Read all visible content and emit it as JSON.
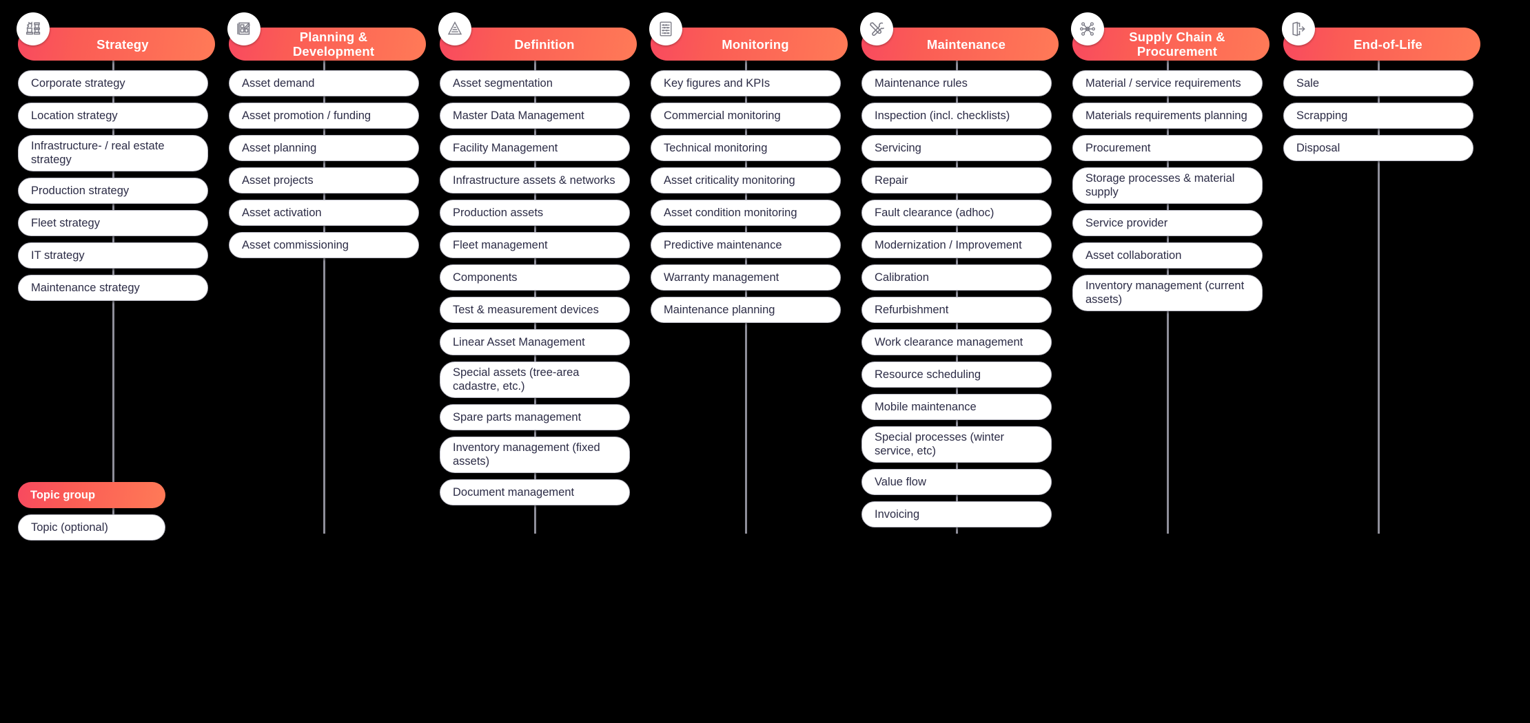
{
  "theme": {
    "background": "#000000",
    "accent_start": "#f8495f",
    "accent_end": "#ff7a57",
    "pill_background": "#ffffff",
    "pill_text": "#2c2c46",
    "connector": "#8e8e99"
  },
  "legend": {
    "group_label": "Topic group",
    "topic_label": "Topic (optional)"
  },
  "columns": [
    {
      "id": "strategy",
      "title": "Strategy",
      "icon": "chess-pieces-icon",
      "items": [
        "Corporate strategy",
        "Location strategy",
        "Infrastructure- / real estate strategy",
        "Production strategy",
        "Fleet strategy",
        "IT strategy",
        "Maintenance strategy"
      ]
    },
    {
      "id": "planning-development",
      "title": "Planning  &\nDevelopment",
      "icon": "blueprint-icon",
      "items": [
        "Asset demand",
        "Asset promotion / funding",
        "Asset planning",
        "Asset projects",
        "Asset activation",
        "Asset commissioning"
      ]
    },
    {
      "id": "definition",
      "title": "Definition",
      "icon": "pyramid-icon",
      "items": [
        "Asset segmentation",
        "Master Data Management",
        "Facility Management",
        "Infrastructure assets & networks",
        "Production assets",
        "Fleet management",
        "Components",
        "Test & measurement devices",
        "Linear Asset Management",
        "Special assets (tree-area cadastre, etc.)",
        "Spare parts management",
        "Inventory management (fixed assets)",
        "Document management"
      ]
    },
    {
      "id": "monitoring",
      "title": "Monitoring",
      "icon": "abacus-icon",
      "items": [
        "Key figures and KPIs",
        "Commercial monitoring",
        "Technical monitoring",
        "Asset criticality monitoring",
        "Asset condition monitoring",
        "Predictive maintenance",
        "Warranty management",
        "Maintenance planning"
      ]
    },
    {
      "id": "maintenance",
      "title": "Maintenance",
      "icon": "tools-icon",
      "items": [
        "Maintenance rules",
        "Inspection (incl. checklists)",
        "Servicing",
        "Repair",
        "Fault clearance (adhoc)",
        "Modernization / Improvement",
        "Calibration",
        "Refurbishment",
        "Work clearance management",
        "Resource scheduling",
        "Mobile maintenance",
        "Special processes (winter service, etc)",
        "Value flow",
        "Invoicing"
      ]
    },
    {
      "id": "supply-chain-procurement",
      "title": "Supply Chain &\nProcurement",
      "icon": "network-hub-icon",
      "items": [
        "Material / service requirements",
        "Materials requirements planning",
        "Procurement",
        "Storage processes & material supply",
        "Service provider",
        "Asset collaboration",
        "Inventory management (current assets)"
      ]
    },
    {
      "id": "end-of-life",
      "title": "End-of-Life",
      "icon": "exit-door-icon",
      "items": [
        "Sale",
        "Scrapping",
        "Disposal"
      ]
    }
  ]
}
